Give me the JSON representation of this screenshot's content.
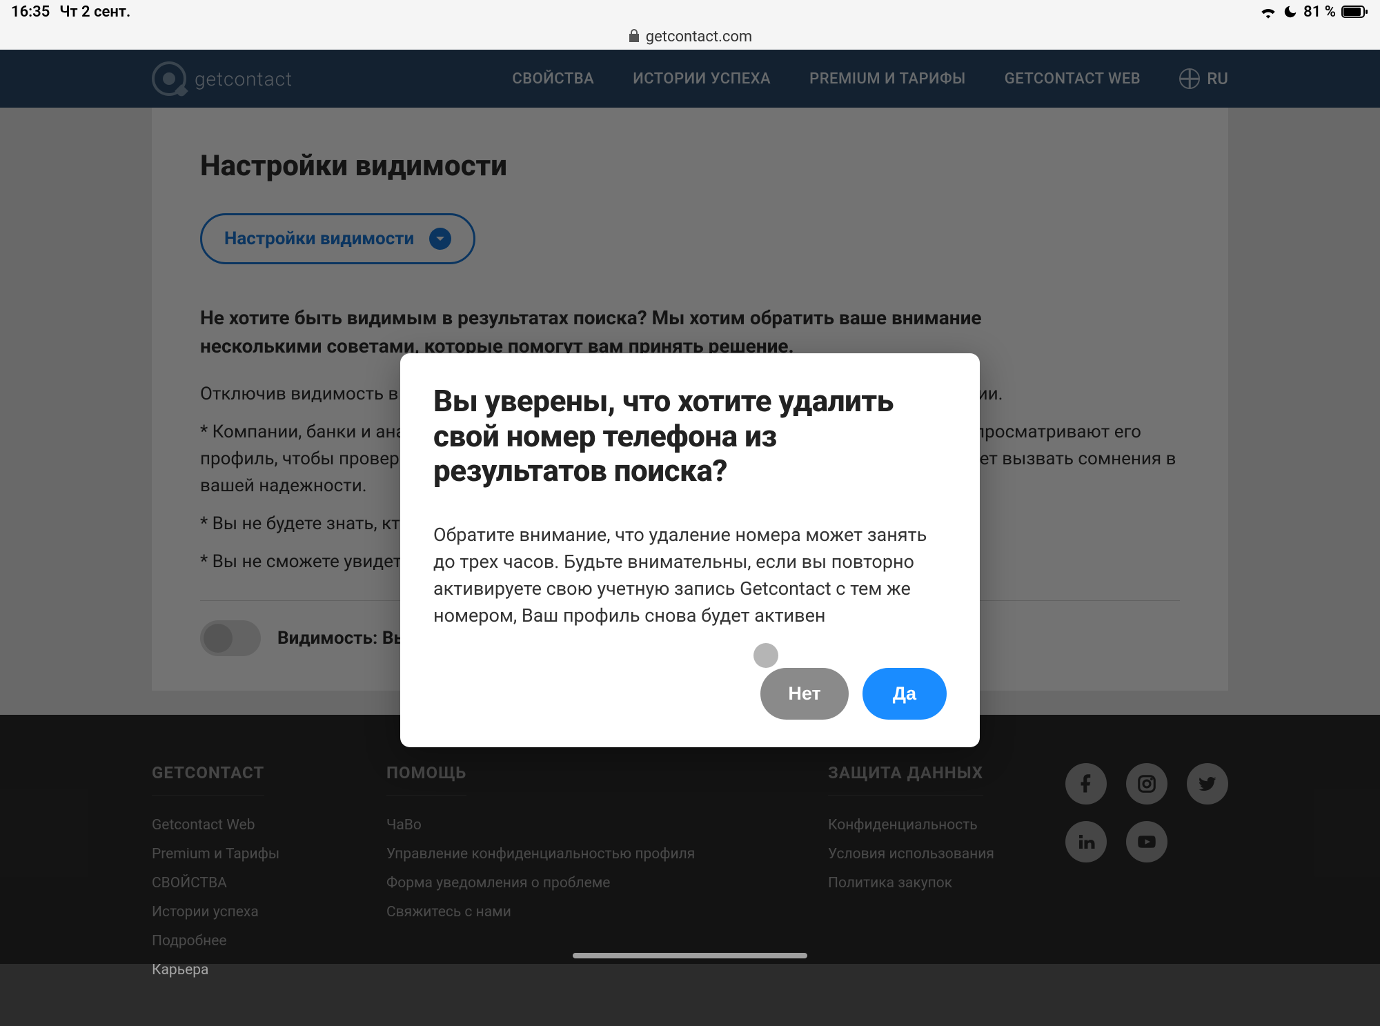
{
  "status_bar": {
    "time": "16:35",
    "date": "Чт 2 сент.",
    "battery_text": "81 %"
  },
  "url_bar": {
    "domain": "getcontact.com"
  },
  "nav": {
    "brand": "getcontact",
    "links": [
      "СВОЙСТВА",
      "ИСТОРИИ УСПЕХА",
      "PREMIUM И ТАРИФЫ",
      "GETCONTACT WEB"
    ],
    "lang": "RU"
  },
  "card": {
    "title": "Настройки видимости",
    "pill_label": "Настройки видимости",
    "lead": "Не хотите быть видимым в результатах поиска? Мы хотим обратить ваше внимание несколькими советами, которые помогут вам принять решение.",
    "paragraph": "Отключив видимость в результатах поиска, вы не сможете использовать некоторые функции.",
    "bullets": [
      "* Компании, банки и аналогичные организации, с которыми вы хотите иметь дело, обычно просматривают его профиль, чтобы проверить надежность человека. Отключение видимости в Getcontact может вызвать сомнения в вашей надежности.",
      "* Вы не будете знать, кто и когда будет искать ваш номер телефона в Getcontact.",
      "* Вы не сможете увидеть теги, добавленные для вашего профиля."
    ],
    "toggle_label": "Видимость: Выключена"
  },
  "modal": {
    "title": "Вы уверены, что хотите удалить свой номер телефона из результатов поиска?",
    "body": "Обратите внимание, что удаление номера может занять до трех часов. Будьте внимательны, если вы повторно активируете свою учетную запись Getcontact с тем же номером, Ваш профиль снова будет активен",
    "no": "Нет",
    "yes": "Да"
  },
  "footer": {
    "col1": {
      "title": "GETCONTACT",
      "items": [
        "Getcontact Web",
        "Premium и Тарифы",
        "СВОЙСТВА",
        "Истории успеха",
        "Подробнее",
        "Карьера"
      ]
    },
    "col2": {
      "title": "ПОМОЩЬ",
      "items": [
        "ЧаВо",
        "Управление конфиденциальностью профиля",
        "Форма уведомления о проблеме",
        "Свяжитесь с нами"
      ]
    },
    "col3": {
      "title": "ЗАЩИТА ДАННЫХ",
      "items": [
        "Конфиденциальность",
        "Условия использования",
        "Политика закупок"
      ]
    }
  }
}
